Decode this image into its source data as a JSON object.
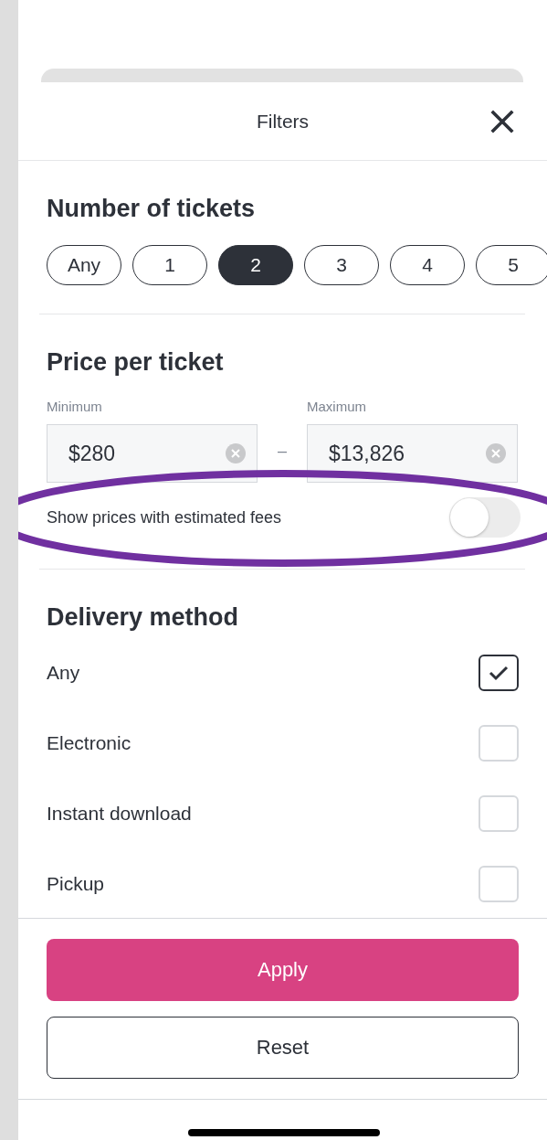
{
  "header": {
    "title": "Filters"
  },
  "tickets": {
    "heading": "Number of tickets",
    "options": [
      {
        "label": "Any",
        "selected": false
      },
      {
        "label": "1",
        "selected": false
      },
      {
        "label": "2",
        "selected": true
      },
      {
        "label": "3",
        "selected": false
      },
      {
        "label": "4",
        "selected": false
      },
      {
        "label": "5",
        "selected": false
      }
    ]
  },
  "price": {
    "heading": "Price per ticket",
    "min": {
      "label": "Minimum",
      "value": "$280"
    },
    "separator": "–",
    "max": {
      "label": "Maximum",
      "value": "$13,826"
    },
    "fees_toggle": {
      "label": "Show prices with estimated fees",
      "on": false
    }
  },
  "delivery": {
    "heading": "Delivery method",
    "options": [
      {
        "label": "Any",
        "checked": true
      },
      {
        "label": "Electronic",
        "checked": false
      },
      {
        "label": "Instant download",
        "checked": false
      },
      {
        "label": "Pickup",
        "checked": false
      }
    ]
  },
  "buttons": {
    "apply": "Apply",
    "reset": "Reset"
  }
}
